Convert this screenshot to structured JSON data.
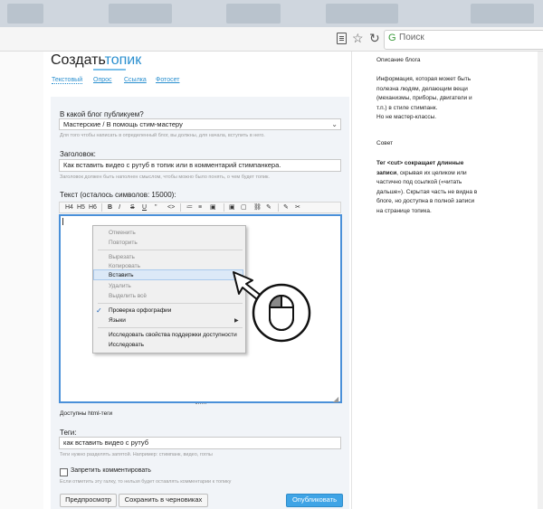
{
  "browser": {
    "search_placeholder": "Поиск"
  },
  "page": {
    "title_part1": "Создать",
    "title_part2": "топик",
    "tabs": [
      "Текстовый",
      "Опрос",
      "Ссылка",
      "Фотосет"
    ]
  },
  "form": {
    "blog_label": "В какой блог публикуем?",
    "blog_value": "Мастерские / В помощь стим-мастеру",
    "blog_hint": "Для того чтобы написать в определенный блог, вы должны, для начала, вступить в него.",
    "title_label": "Заголовок:",
    "title_value": "Как вставить видео с рутуб в топик или в комментарий стимпанкера.",
    "title_hint": "Заголовок должен быть наполнен смыслом, чтобы можно было понять, о чем будет топик.",
    "text_label": "Текст (осталось символов: 15000):",
    "toolbar": [
      "H4",
      "H5",
      "H6",
      "B",
      "I",
      "S",
      "U",
      "\"",
      "<>",
      "≔",
      "≡",
      "▣",
      "▢",
      "⛓",
      "✎",
      "✂"
    ],
    "html_tags_link": "Доступны html-теги",
    "tags_label": "Теги:",
    "tags_value": "как вставить видео с рутуб",
    "tags_hint": "Теги нужно разделять запятой. Например: стимпанк, видео, гоглы",
    "no_comments_label": "Запретить комментировать",
    "no_comments_hint": "Если отметить эту галку, то нельзя будет оставлять комментарии к топику",
    "preview_button": "Предпросмотр",
    "save_draft_button": "Сохранить в черновиках",
    "publish_button": "Опубликовать"
  },
  "context_menu": {
    "items": [
      {
        "label": "Отменить",
        "enabled": false
      },
      {
        "label": "Повторить",
        "enabled": false
      },
      {
        "label": "Вырезать",
        "enabled": false
      },
      {
        "label": "Копировать",
        "enabled": false
      },
      {
        "label": "Вставить",
        "enabled": true,
        "highlighted": true
      },
      {
        "label": "Удалить",
        "enabled": false
      },
      {
        "label": "Выделить всё",
        "enabled": false
      },
      {
        "label": "Проверка орфографии",
        "enabled": true,
        "checked": true
      },
      {
        "label": "Языки",
        "enabled": true,
        "submenu": true
      },
      {
        "label": "Исследовать свойства поддержки доступности",
        "enabled": true
      },
      {
        "label": "Исследовать",
        "enabled": true
      }
    ]
  },
  "sidebar": {
    "about_heading": "Описание блога",
    "about_text_1": "Информация, которая может быть",
    "about_text_2": "полезна людям, делающим вещи",
    "about_text_3": "(механизмы, приборы, двигатели и",
    "about_text_4": "т.п.) в стиле стимпанк.",
    "about_text_5": "Но не мастер-классы.",
    "tip_heading": "Совет",
    "tip_bold_1": "Тег <cut> сокращает длинные",
    "tip_bold_2": "записи",
    "tip_rest_2": ", скрывая их целиком или",
    "tip_text_3": "частично под ссылкой («читать",
    "tip_text_4": "дальше»). Скрытая часть не видна в",
    "tip_text_5": "блоге, но доступна в полной записи",
    "tip_text_6": "на странице топика."
  },
  "colors": {
    "accent": "#2a8fcf",
    "publish": "#3fa4e6",
    "editor_border": "#4a90d9"
  }
}
